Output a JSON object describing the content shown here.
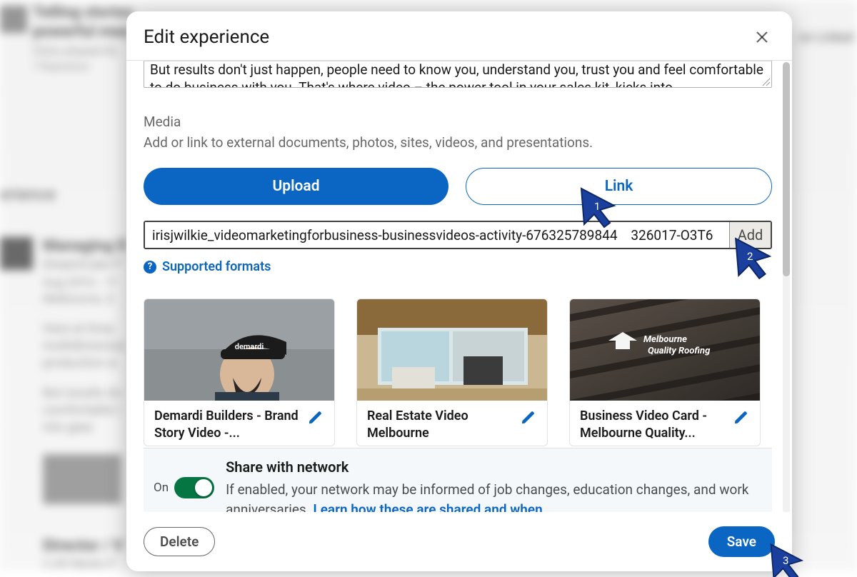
{
  "modal": {
    "title": "Edit experience",
    "description": "But results don't just happen, people need to know you, understand you, trust you and feel comfortable to do business with you. That's where video – the power tool in your sales kit, kicks into",
    "media_heading": "Media",
    "media_hint": "Add or link to external documents, photos, sites, videos, and presentations.",
    "upload_label": "Upload",
    "link_label": "Link",
    "link_value": "irisjwilkie_videomarketingforbusiness-businessvideos-activity-676325789844    326017-O3T6",
    "add_label": "Add",
    "supported_label": "Supported formats",
    "cards": [
      {
        "title": "Demardi Builders - Brand Story Video -...",
        "brand": "demardi"
      },
      {
        "title": "Real Estate Video Melbourne",
        "brand": ""
      },
      {
        "title": "Business Video Card - Melbourne Quality...",
        "brand": "Melbourne Quality Roofing"
      }
    ],
    "share": {
      "title": "Share with network",
      "toggle_state": "On",
      "desc_prefix": "If enabled, your network may be informed of job changes, education changes, and work anniversaries. ",
      "desc_link": "Learn how these are shared and when"
    },
    "delete_label": "Delete",
    "save_label": "Save"
  },
  "background": {
    "l1": "Telling stories",
    "l2": "powerful mea",
    "l3": "Chris shared thi",
    "l4": "7 Reactions",
    "l5": "erience",
    "l6": "Managing D",
    "l7": "DreamCube P",
    "l8": "Aug 2016 – P",
    "l9": "Melbourne, A",
    "l10": "Here at Drea",
    "l11": "multidimensia",
    "l12": "production is",
    "l13": "But results do",
    "l14": "comfortable t",
    "l15": "into gear.",
    "l16": "Director / V",
    "l17": "CJW Media P",
    "r1": "on Linked"
  },
  "annotations": {
    "n1": "1",
    "n2": "2",
    "n3": "3"
  }
}
